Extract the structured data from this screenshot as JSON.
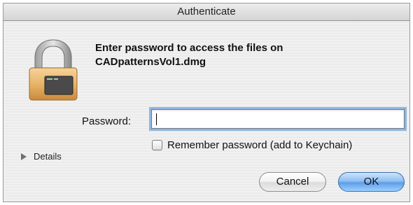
{
  "window": {
    "title": "Authenticate"
  },
  "message": {
    "line1": "Enter password to access the files on",
    "line2": "CADpatternsVol1.dmg"
  },
  "password": {
    "label": "Password:",
    "value": "",
    "placeholder": ""
  },
  "remember": {
    "label": "Remember password (add to Keychain)",
    "checked": false
  },
  "details": {
    "label": "Details"
  },
  "buttons": {
    "cancel": "Cancel",
    "ok": "OK"
  },
  "colors": {
    "focus_ring": "#8db6e6",
    "default_button": "#5e9ee6"
  },
  "icons": {
    "dialog_icon": "padlock-icon",
    "disclosure": "disclosure-triangle-icon"
  }
}
